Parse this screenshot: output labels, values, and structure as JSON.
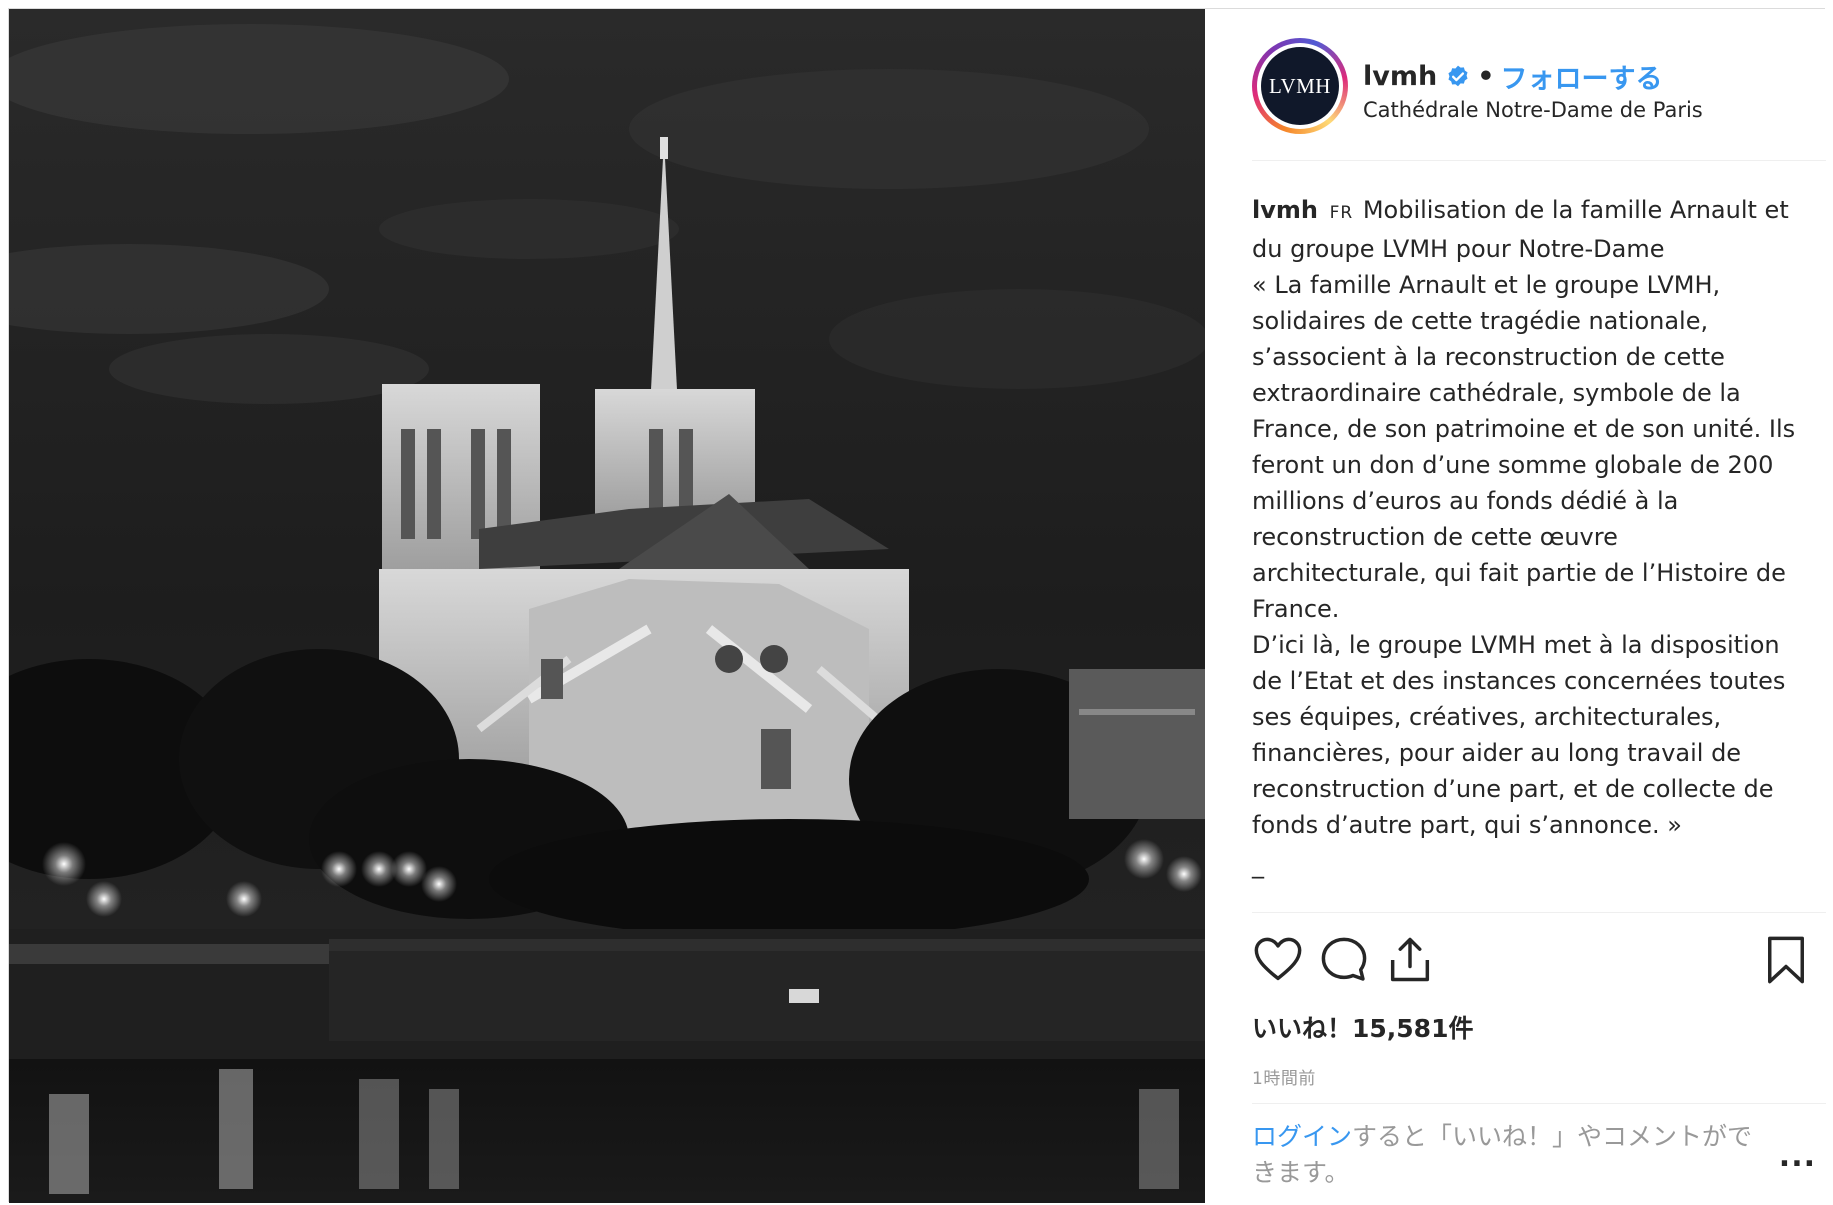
{
  "post": {
    "image_alt": "Cathédrale Notre-Dame de Paris la nuit",
    "header": {
      "avatar_text": "LVMH",
      "username": "lvmh",
      "dot": "•",
      "follow_label": "フォローする",
      "location": "Cathédrale Notre-Dame de Paris"
    },
    "caption": {
      "username": "lvmh",
      "lang": "FR",
      "lines": [
        "Mobilisation de la famille Arnault et du groupe LVMH pour Notre-Dame",
        "« La famille Arnault et le groupe LVMH, solidaires de cette tragédie nationale, s’associent à la reconstruction de cette extraordinaire cathédrale, symbole de la France, de son patrimoine et de son unité. Ils feront un don d’une somme globale de 200 millions d’euros au fonds dédié à la reconstruction de cette œuvre architecturale, qui fait partie de l’Histoire de France.",
        "D’ici là, le groupe LVMH met à la disposition de l’Etat et des instances concernées toutes ses équipes, créatives, architecturales, financières, pour aider au long travail de reconstruction d’une part, et de collecte de fonds d’autre part, qui s’annonce. »",
        "_"
      ]
    },
    "actions": {
      "like_icon": "heart-outline",
      "comment_icon": "speech-bubble",
      "share_icon": "upload-share",
      "save_icon": "bookmark-outline"
    },
    "likes_text": "いいね！15,581件",
    "time_text": "1時間前",
    "login_link": "ログイン",
    "login_text": "すると「いいね！」やコメントができます。",
    "more_label": "..."
  },
  "colors": {
    "link_blue": "#3897f0",
    "text": "#262626",
    "muted": "#999999",
    "border": "#dbdbdb",
    "avatar_bg": "#10182a"
  }
}
